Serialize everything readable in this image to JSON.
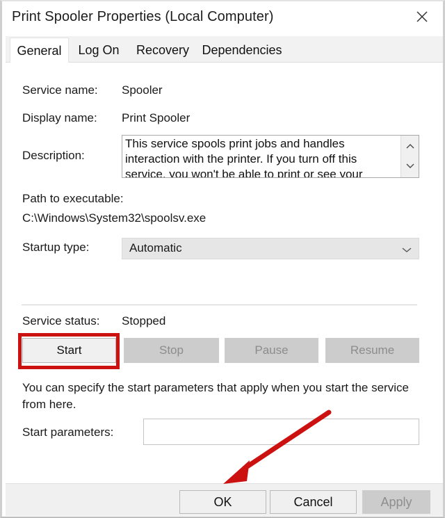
{
  "window": {
    "title": "Print Spooler Properties (Local Computer)",
    "close_icon": "close-icon"
  },
  "tabs": [
    {
      "label": "General",
      "active": true
    },
    {
      "label": "Log On",
      "active": false
    },
    {
      "label": "Recovery",
      "active": false
    },
    {
      "label": "Dependencies",
      "active": false
    }
  ],
  "general": {
    "service_name_label": "Service name:",
    "service_name_value": "Spooler",
    "display_name_label": "Display name:",
    "display_name_value": "Print Spooler",
    "description_label": "Description:",
    "description_value": "This service spools print jobs and handles interaction with the printer.  If you turn off this service, you won't be able to print or see your printers.",
    "scroll_up_icon": "chevron-up-icon",
    "scroll_down_icon": "chevron-down-icon",
    "path_label": "Path to executable:",
    "path_value": "C:\\Windows\\System32\\spoolsv.exe",
    "startup_type_label": "Startup type:",
    "startup_type_value": "Automatic",
    "startup_caret_icon": "chevron-down-icon",
    "service_status_label": "Service status:",
    "service_status_value": "Stopped",
    "service_buttons": [
      {
        "label": "Start",
        "enabled": true
      },
      {
        "label": "Stop",
        "enabled": false
      },
      {
        "label": "Pause",
        "enabled": false
      },
      {
        "label": "Resume",
        "enabled": false
      }
    ],
    "helper_text": "You can specify the start parameters that apply when you start the service from here.",
    "start_parameters_label": "Start parameters:",
    "start_parameters_value": "",
    "start_parameters_placeholder": ""
  },
  "footer": {
    "ok_label": "OK",
    "cancel_label": "Cancel",
    "apply_label": "Apply",
    "apply_enabled": false
  },
  "annotations": {
    "highlight_color": "#cc1111",
    "arrow_color": "#cc1111",
    "highlight_target": "Start",
    "arrow_target": "OK"
  }
}
